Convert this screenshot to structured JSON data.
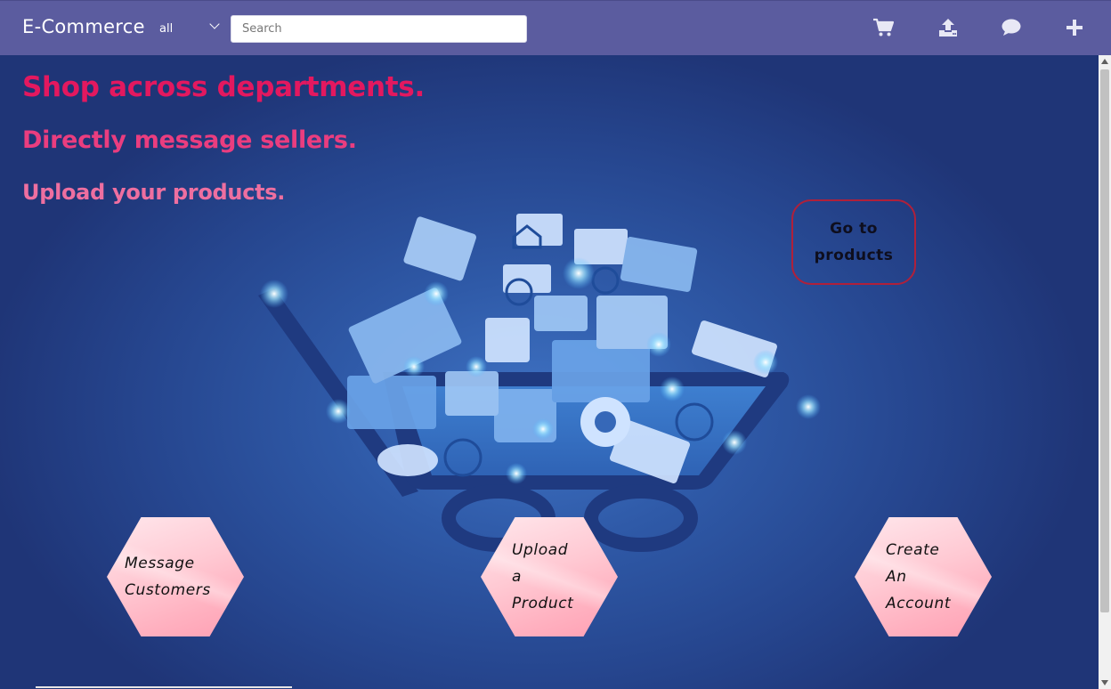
{
  "navbar": {
    "brand": "E-Commerce",
    "category_select": {
      "selected": "all"
    },
    "search": {
      "placeholder": "Search",
      "value": ""
    },
    "icons": [
      "cart-icon",
      "upload-icon",
      "message-icon",
      "plus-icon"
    ]
  },
  "hero": {
    "line1": "Shop across departments.",
    "line2": "Directly message sellers.",
    "line3": "Upload your products.",
    "goto_button": {
      "line1": "Go to",
      "line2": "products"
    }
  },
  "actions": {
    "message": {
      "line1": "Message",
      "line2": "Customers"
    },
    "upload": {
      "line1": "Upload",
      "line2": "a",
      "line3": "Product"
    },
    "account": {
      "line1": "Create",
      "line2": "An",
      "line3": "Account"
    }
  },
  "colors": {
    "navbar": "#5b5c9f",
    "headline1": "#e3185f",
    "headline2": "#ea3d7f",
    "headline3": "#ee6fa0",
    "hexagon": "#ffc9d3",
    "goto_border": "#b0203a"
  }
}
